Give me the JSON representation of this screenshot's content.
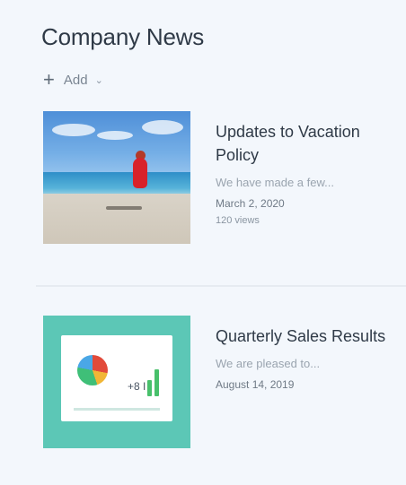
{
  "webpart": {
    "title": "Company News",
    "add_label": "Add",
    "add_icon": "plus-icon",
    "dropdown_icon": "chevron-down-icon"
  },
  "news": [
    {
      "headline": "Updates to Vacation Policy",
      "description": "We have made a few...",
      "date": "March 2, 2020",
      "views": "120 views"
    },
    {
      "headline": "Quarterly Sales Results",
      "description": "We are pleased to...",
      "date": "August 14, 2019"
    }
  ],
  "thumb2_label": "+8 I"
}
